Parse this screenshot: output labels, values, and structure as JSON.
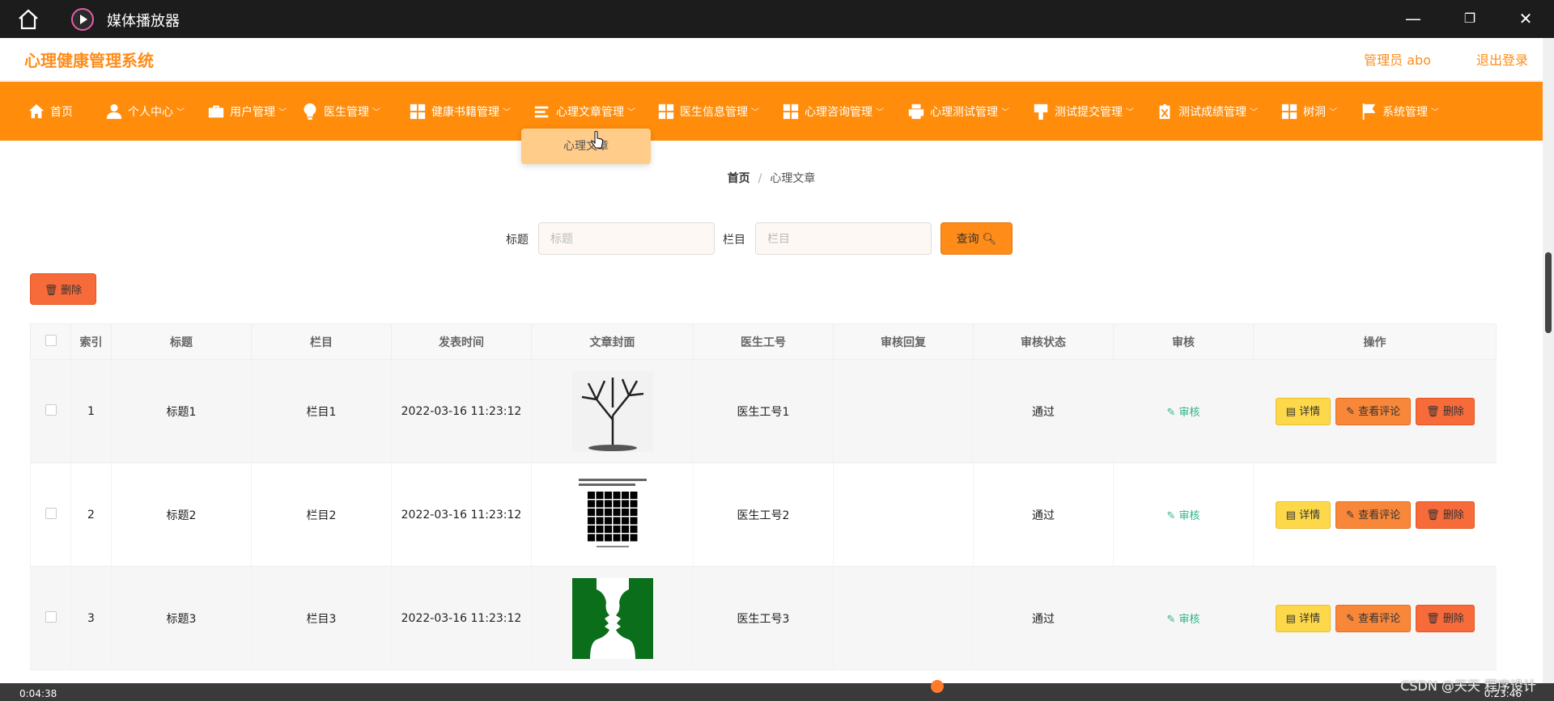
{
  "window": {
    "title": "媒体播放器"
  },
  "header": {
    "system_name": "心理健康管理系统",
    "admin_label": "管理员 abo",
    "logout_label": "退出登录"
  },
  "nav": [
    {
      "label": "首页",
      "icon": "home-icon",
      "dropdown": false
    },
    {
      "label": "个人中心",
      "icon": "user-icon",
      "dropdown": true
    },
    {
      "label": "用户管理",
      "icon": "briefcase-icon",
      "dropdown": true
    },
    {
      "label": "医生管理",
      "icon": "bulb-icon",
      "dropdown": true
    },
    {
      "label": "健康书籍管理",
      "icon": "grid-icon",
      "dropdown": true
    },
    {
      "label": "心理文章管理",
      "icon": "menu-lines-icon",
      "dropdown": true
    },
    {
      "label": "医生信息管理",
      "icon": "grid-icon",
      "dropdown": true
    },
    {
      "label": "心理咨询管理",
      "icon": "grid-icon",
      "dropdown": true
    },
    {
      "label": "心理测试管理",
      "icon": "printer-icon",
      "dropdown": true
    },
    {
      "label": "测试提交管理",
      "icon": "brush-icon",
      "dropdown": true
    },
    {
      "label": "测试成绩管理",
      "icon": "clipboard-x-icon",
      "dropdown": true
    },
    {
      "label": "树洞",
      "icon": "grid-icon",
      "dropdown": true
    },
    {
      "label": "系统管理",
      "icon": "flag-icon",
      "dropdown": true
    }
  ],
  "dropdown": {
    "item": "心理文章"
  },
  "breadcrumb": {
    "home": "首页",
    "separator": "/",
    "current": "心理文章"
  },
  "search": {
    "title_label": "标题",
    "title_placeholder": "标题",
    "column_label": "栏目",
    "column_placeholder": "栏目",
    "query_label": "查询"
  },
  "toolbar": {
    "delete_label": "删除"
  },
  "table": {
    "headers": [
      "索引",
      "标题",
      "栏目",
      "发表时间",
      "文章封面",
      "医生工号",
      "审核回复",
      "审核状态",
      "审核",
      "操作"
    ],
    "rows": [
      {
        "index": "1",
        "title": "标题1",
        "column": "栏目1",
        "time": "2022-03-16 11:23:12",
        "cover": "tree",
        "doctor": "医生工号1",
        "reply": "",
        "status": "通过",
        "audit": "审核"
      },
      {
        "index": "2",
        "title": "标题2",
        "column": "栏目2",
        "time": "2022-03-16 11:23:12",
        "cover": "grid",
        "doctor": "医生工号2",
        "reply": "",
        "status": "通过",
        "audit": "审核"
      },
      {
        "index": "3",
        "title": "标题3",
        "column": "栏目3",
        "time": "2022-03-16 11:23:12",
        "cover": "faces",
        "doctor": "医生工号3",
        "reply": "",
        "status": "通过",
        "audit": "审核"
      }
    ],
    "actions": {
      "detail": "详情",
      "comments": "查看评论",
      "delete": "删除"
    }
  },
  "player": {
    "elapsed": "0:04:38",
    "total": "0:23:46"
  },
  "watermark": "CSDN @天天 程序设计",
  "colors": {
    "accent": "#ff8c0a",
    "audit": "#2fb48a",
    "detail_btn": "#fdd84a",
    "comment_btn": "#f8873a",
    "delete_btn": "#f76a3a"
  }
}
